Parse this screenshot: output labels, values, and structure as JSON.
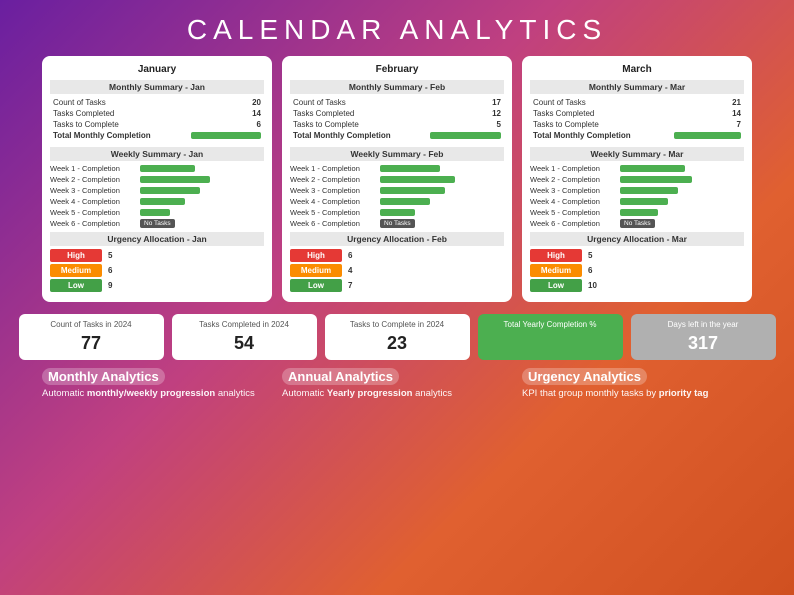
{
  "title": "CALENDAR ANALYTICS",
  "months": [
    {
      "name": "January",
      "summary_header": "Monthly Summary - Jan",
      "count_tasks": 20,
      "tasks_completed": 14,
      "tasks_to_complete": 6,
      "total_monthly_bar": 70,
      "weekly_header": "Weekly Summary - Jan",
      "weeks": [
        {
          "label": "Week 1 - Completion",
          "bar": 55,
          "no_tasks": false
        },
        {
          "label": "Week 2 - Completion",
          "bar": 70,
          "no_tasks": false
        },
        {
          "label": "Week 3 - Completion",
          "bar": 60,
          "no_tasks": false
        },
        {
          "label": "Week 4 - Completion",
          "bar": 45,
          "no_tasks": false
        },
        {
          "label": "Week 5 - Completion",
          "bar": 30,
          "no_tasks": false
        },
        {
          "label": "Week 6 - Completion",
          "bar": 0,
          "no_tasks": true
        }
      ],
      "urgency_header": "Urgency Allocation - Jan",
      "high": 5,
      "medium": 6,
      "low": 9
    },
    {
      "name": "February",
      "summary_header": "Monthly Summary - Feb",
      "count_tasks": 17,
      "tasks_completed": 12,
      "tasks_to_complete": 5,
      "total_monthly_bar": 71,
      "weekly_header": "Weekly Summary - Feb",
      "weeks": [
        {
          "label": "Week 1 - Completion",
          "bar": 60,
          "no_tasks": false
        },
        {
          "label": "Week 2 - Completion",
          "bar": 75,
          "no_tasks": false
        },
        {
          "label": "Week 3 - Completion",
          "bar": 65,
          "no_tasks": false
        },
        {
          "label": "Week 4 - Completion",
          "bar": 50,
          "no_tasks": false
        },
        {
          "label": "Week 5 - Completion",
          "bar": 35,
          "no_tasks": false
        },
        {
          "label": "Week 6 - Completion",
          "bar": 0,
          "no_tasks": true
        }
      ],
      "urgency_header": "Urgency Allocation - Feb",
      "high": 6,
      "medium": 4,
      "low": 7
    },
    {
      "name": "March",
      "summary_header": "Monthly Summary - Mar",
      "count_tasks": 21,
      "tasks_completed": 14,
      "tasks_to_complete": 7,
      "total_monthly_bar": 67,
      "weekly_header": "Weekly Summary - Mar",
      "weeks": [
        {
          "label": "Week 1 - Completion",
          "bar": 65,
          "no_tasks": false
        },
        {
          "label": "Week 2 - Completion",
          "bar": 72,
          "no_tasks": false
        },
        {
          "label": "Week 3 - Completion",
          "bar": 58,
          "no_tasks": false
        },
        {
          "label": "Week 4 - Completion",
          "bar": 48,
          "no_tasks": false
        },
        {
          "label": "Week 5 - Completion",
          "bar": 38,
          "no_tasks": false
        },
        {
          "label": "Week 6 - Completion",
          "bar": 0,
          "no_tasks": true
        }
      ],
      "urgency_header": "Urgency Allocation - Mar",
      "high": 5,
      "medium": 6,
      "low": 10
    }
  ],
  "stats": {
    "count_label": "Count of Tasks in 2024",
    "count_value": "77",
    "completed_label": "Tasks Completed in 2024",
    "completed_value": "54",
    "to_complete_label": "Tasks to Complete in 2024",
    "to_complete_value": "23",
    "yearly_label": "Total Yearly Completion %",
    "days_label": "Days left in the year",
    "days_value": "317"
  },
  "features": [
    {
      "title": "Monthly Analytics",
      "desc_plain": "Automatic ",
      "desc_bold": "monthly/weekly\nprogression",
      "desc_plain2": " analytics"
    },
    {
      "title": "Annual Analytics",
      "desc_plain": "Automatic ",
      "desc_bold": "Yearly\nprogression",
      "desc_plain2": " analytics"
    },
    {
      "title": "Urgency Analytics",
      "desc_plain": "KPI that group monthly\ntasks by ",
      "desc_bold": "priority tag",
      "desc_plain2": ""
    }
  ],
  "labels": {
    "count_of_tasks": "Count of Tasks",
    "tasks_completed": "Tasks Completed",
    "tasks_to_complete": "Tasks to Complete",
    "total_monthly_completion": "Total Monthly Completion",
    "high": "High",
    "medium": "Medium",
    "low": "Low",
    "no_tasks": "No Tasks"
  }
}
